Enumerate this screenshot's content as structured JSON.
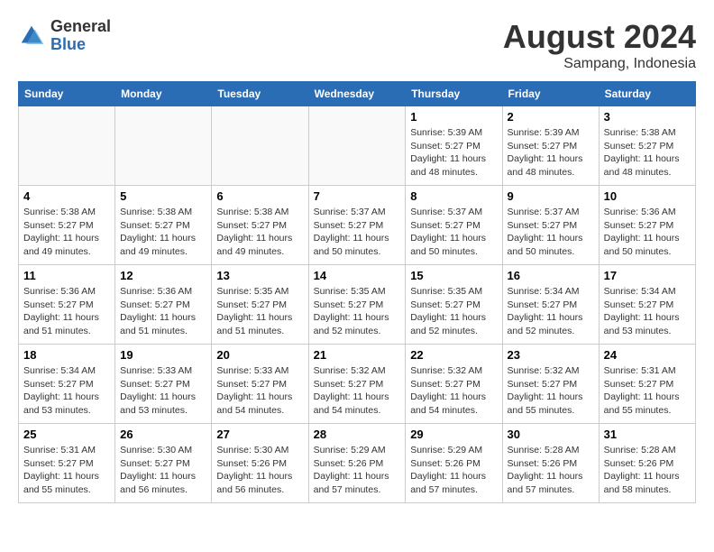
{
  "header": {
    "logo_general": "General",
    "logo_blue": "Blue",
    "month_year": "August 2024",
    "location": "Sampang, Indonesia"
  },
  "days_of_week": [
    "Sunday",
    "Monday",
    "Tuesday",
    "Wednesday",
    "Thursday",
    "Friday",
    "Saturday"
  ],
  "weeks": [
    [
      {
        "day": "",
        "info": "",
        "empty": true
      },
      {
        "day": "",
        "info": "",
        "empty": true
      },
      {
        "day": "",
        "info": "",
        "empty": true
      },
      {
        "day": "",
        "info": "",
        "empty": true
      },
      {
        "day": "1",
        "info": "Sunrise: 5:39 AM\nSunset: 5:27 PM\nDaylight: 11 hours\nand 48 minutes."
      },
      {
        "day": "2",
        "info": "Sunrise: 5:39 AM\nSunset: 5:27 PM\nDaylight: 11 hours\nand 48 minutes."
      },
      {
        "day": "3",
        "info": "Sunrise: 5:38 AM\nSunset: 5:27 PM\nDaylight: 11 hours\nand 48 minutes."
      }
    ],
    [
      {
        "day": "4",
        "info": "Sunrise: 5:38 AM\nSunset: 5:27 PM\nDaylight: 11 hours\nand 49 minutes."
      },
      {
        "day": "5",
        "info": "Sunrise: 5:38 AM\nSunset: 5:27 PM\nDaylight: 11 hours\nand 49 minutes."
      },
      {
        "day": "6",
        "info": "Sunrise: 5:38 AM\nSunset: 5:27 PM\nDaylight: 11 hours\nand 49 minutes."
      },
      {
        "day": "7",
        "info": "Sunrise: 5:37 AM\nSunset: 5:27 PM\nDaylight: 11 hours\nand 50 minutes."
      },
      {
        "day": "8",
        "info": "Sunrise: 5:37 AM\nSunset: 5:27 PM\nDaylight: 11 hours\nand 50 minutes."
      },
      {
        "day": "9",
        "info": "Sunrise: 5:37 AM\nSunset: 5:27 PM\nDaylight: 11 hours\nand 50 minutes."
      },
      {
        "day": "10",
        "info": "Sunrise: 5:36 AM\nSunset: 5:27 PM\nDaylight: 11 hours\nand 50 minutes."
      }
    ],
    [
      {
        "day": "11",
        "info": "Sunrise: 5:36 AM\nSunset: 5:27 PM\nDaylight: 11 hours\nand 51 minutes."
      },
      {
        "day": "12",
        "info": "Sunrise: 5:36 AM\nSunset: 5:27 PM\nDaylight: 11 hours\nand 51 minutes."
      },
      {
        "day": "13",
        "info": "Sunrise: 5:35 AM\nSunset: 5:27 PM\nDaylight: 11 hours\nand 51 minutes."
      },
      {
        "day": "14",
        "info": "Sunrise: 5:35 AM\nSunset: 5:27 PM\nDaylight: 11 hours\nand 52 minutes."
      },
      {
        "day": "15",
        "info": "Sunrise: 5:35 AM\nSunset: 5:27 PM\nDaylight: 11 hours\nand 52 minutes."
      },
      {
        "day": "16",
        "info": "Sunrise: 5:34 AM\nSunset: 5:27 PM\nDaylight: 11 hours\nand 52 minutes."
      },
      {
        "day": "17",
        "info": "Sunrise: 5:34 AM\nSunset: 5:27 PM\nDaylight: 11 hours\nand 53 minutes."
      }
    ],
    [
      {
        "day": "18",
        "info": "Sunrise: 5:34 AM\nSunset: 5:27 PM\nDaylight: 11 hours\nand 53 minutes."
      },
      {
        "day": "19",
        "info": "Sunrise: 5:33 AM\nSunset: 5:27 PM\nDaylight: 11 hours\nand 53 minutes."
      },
      {
        "day": "20",
        "info": "Sunrise: 5:33 AM\nSunset: 5:27 PM\nDaylight: 11 hours\nand 54 minutes."
      },
      {
        "day": "21",
        "info": "Sunrise: 5:32 AM\nSunset: 5:27 PM\nDaylight: 11 hours\nand 54 minutes."
      },
      {
        "day": "22",
        "info": "Sunrise: 5:32 AM\nSunset: 5:27 PM\nDaylight: 11 hours\nand 54 minutes."
      },
      {
        "day": "23",
        "info": "Sunrise: 5:32 AM\nSunset: 5:27 PM\nDaylight: 11 hours\nand 55 minutes."
      },
      {
        "day": "24",
        "info": "Sunrise: 5:31 AM\nSunset: 5:27 PM\nDaylight: 11 hours\nand 55 minutes."
      }
    ],
    [
      {
        "day": "25",
        "info": "Sunrise: 5:31 AM\nSunset: 5:27 PM\nDaylight: 11 hours\nand 55 minutes."
      },
      {
        "day": "26",
        "info": "Sunrise: 5:30 AM\nSunset: 5:27 PM\nDaylight: 11 hours\nand 56 minutes."
      },
      {
        "day": "27",
        "info": "Sunrise: 5:30 AM\nSunset: 5:26 PM\nDaylight: 11 hours\nand 56 minutes."
      },
      {
        "day": "28",
        "info": "Sunrise: 5:29 AM\nSunset: 5:26 PM\nDaylight: 11 hours\nand 57 minutes."
      },
      {
        "day": "29",
        "info": "Sunrise: 5:29 AM\nSunset: 5:26 PM\nDaylight: 11 hours\nand 57 minutes."
      },
      {
        "day": "30",
        "info": "Sunrise: 5:28 AM\nSunset: 5:26 PM\nDaylight: 11 hours\nand 57 minutes."
      },
      {
        "day": "31",
        "info": "Sunrise: 5:28 AM\nSunset: 5:26 PM\nDaylight: 11 hours\nand 58 minutes."
      }
    ]
  ]
}
